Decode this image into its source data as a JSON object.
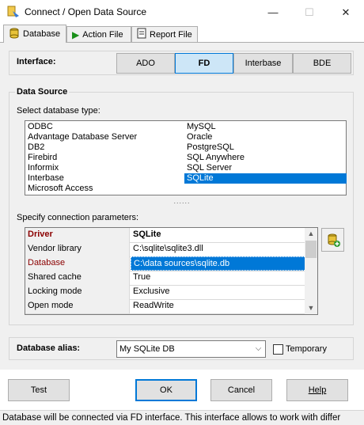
{
  "window": {
    "title": "Connect / Open Data Source",
    "minimize": "—",
    "maximize": "☐",
    "close": "✕"
  },
  "tabs": [
    {
      "label": "Database"
    },
    {
      "label": "Action File"
    },
    {
      "label": "Report File"
    }
  ],
  "interface": {
    "label": "Interface:",
    "options": [
      "ADO",
      "FD",
      "Interbase",
      "BDE"
    ],
    "selected": "FD"
  },
  "data_source": {
    "title": "Data Source",
    "type_label": "Select database type:",
    "types_col1": [
      "ODBC",
      "Advantage Database Server",
      "DB2",
      "Firebird",
      "Informix",
      "Interbase",
      "Microsoft Access"
    ],
    "types_col2": [
      "MySQL",
      "Oracle",
      "PostgreSQL",
      "SQL Anywhere",
      "SQL Server",
      "SQLite"
    ],
    "selected_type": "SQLite",
    "splitter": "......",
    "params_label": "Specify connection parameters:",
    "params_header": {
      "key": "Driver",
      "value": "SQLite"
    },
    "params": [
      {
        "key": "Vendor library",
        "value": "C:\\sqlite\\sqlite3.dll"
      },
      {
        "key": "Database",
        "value": "C:\\data sources\\sqlite.db"
      },
      {
        "key": "Shared cache",
        "value": "True"
      },
      {
        "key": "Locking mode",
        "value": "Exclusive"
      },
      {
        "key": "Open mode",
        "value": "ReadWrite"
      }
    ],
    "selected_param": "Database"
  },
  "alias": {
    "label": "Database alias:",
    "value": "My SQLite DB",
    "temporary_label": "Temporary",
    "temporary_checked": false
  },
  "buttons": {
    "test": "Test",
    "ok": "OK",
    "cancel": "Cancel",
    "help": "Help"
  },
  "status": "Database will be connected via FD interface. This interface allows to work with differ",
  "colors": {
    "selection": "#0078d7",
    "driver_key": "#8b0000",
    "panel": "#f0f0f0"
  }
}
